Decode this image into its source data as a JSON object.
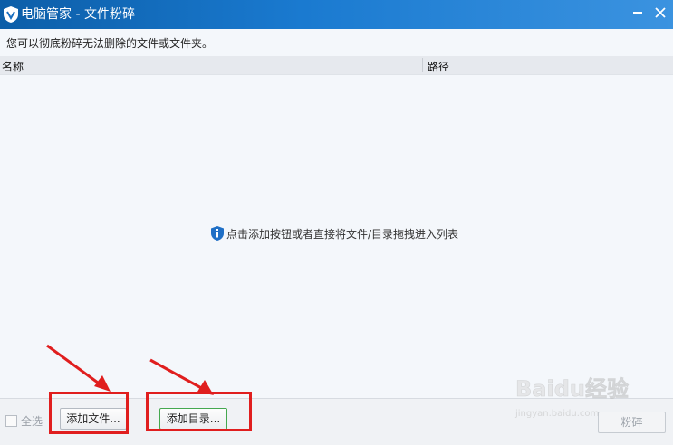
{
  "window": {
    "title": "电脑管家 - 文件粉碎",
    "minimize_icon": "minimize-icon",
    "close_icon": "close-icon"
  },
  "hint": "您可以彻底粉碎无法删除的文件或文件夹。",
  "list": {
    "columns": [
      "名称",
      "路径"
    ],
    "empty_message": "点击添加按钮或者直接将文件/目录拖拽进入列表"
  },
  "footer": {
    "select_all_label": "全选",
    "select_all_checked": false,
    "add_file_label": "添加文件...",
    "add_directory_label": "添加目录...",
    "shred_label": "粉碎"
  },
  "watermark": {
    "brand": "Baidu经验",
    "url": "jingyan.baidu.com"
  },
  "colors": {
    "titlebar": "#1a7ad0",
    "highlight": "#e01e1e",
    "accent_green": "#45a84f"
  }
}
